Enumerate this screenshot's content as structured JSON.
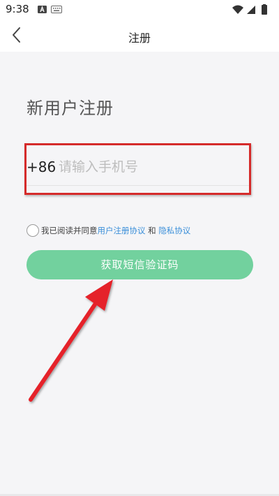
{
  "status_bar": {
    "time": "9:38",
    "left_icons": [
      "font-a-icon",
      "keyboard-icon"
    ],
    "right_icons": [
      "wifi-icon",
      "signal-icon",
      "battery-icon"
    ]
  },
  "header": {
    "title": "注册",
    "back_icon": "chevron-left-icon"
  },
  "form": {
    "page_title": "新用户注册",
    "country_code": "+86",
    "phone_placeholder": "请输入手机号",
    "phone_value": "",
    "agreement_prefix": "我已阅读并同意",
    "user_agreement_link": "用户注册协议",
    "agreement_and": "和",
    "privacy_link": "隐私协议",
    "sms_button_label": "获取短信验证码"
  },
  "colors": {
    "accent_green": "#72d19e",
    "link_blue": "#3b8fd9",
    "annotation_red": "#d52b2b"
  }
}
